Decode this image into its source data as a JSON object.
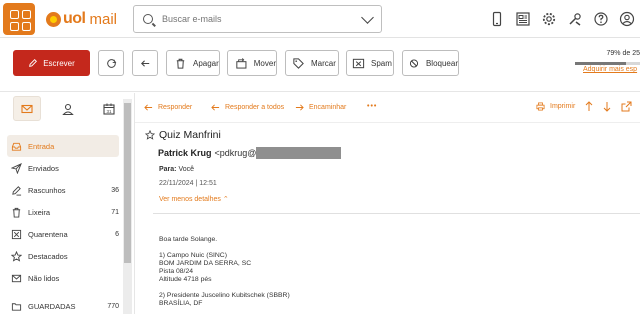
{
  "header": {
    "brand": "uol",
    "product": "mail",
    "search_placeholder": "Buscar e-mails"
  },
  "toolbar": {
    "compose": "Escrever",
    "delete": "Apagar",
    "move": "Mover",
    "mark": "Marcar",
    "spam": "Spam",
    "block": "Bloquear",
    "quota_text": "79% de 25",
    "quota_percent": 79,
    "quota_link": "Adquirir mais esp"
  },
  "sidebar": {
    "folders": [
      {
        "label": "Entrada",
        "count": ""
      },
      {
        "label": "Enviados",
        "count": ""
      },
      {
        "label": "Rascunhos",
        "count": "36"
      },
      {
        "label": "Lixeira",
        "count": "71"
      },
      {
        "label": "Quarentena",
        "count": "6"
      },
      {
        "label": "Destacados",
        "count": ""
      },
      {
        "label": "Não lidos",
        "count": ""
      },
      {
        "label": "GUARDADAS",
        "count": "770"
      }
    ]
  },
  "actions": {
    "reply": "Responder",
    "reply_all": "Responder a todos",
    "forward": "Encaminhar",
    "more": "•••",
    "print": "Imprimir"
  },
  "message": {
    "subject": "Quiz Manfrini",
    "sender_name": "Patrick Krug",
    "sender_email_prefix": "<pdkrug@",
    "to_label": "Para:",
    "to_value": "Você",
    "date": "22/11/2024 | 12:51",
    "details_link": "Ver menos detalhes",
    "body": [
      "Boa tarde Solange.",
      "",
      "1) Campo Nuic (SINC)",
      "BOM JARDIM DA SERRA, SC",
      "Pista 08/24",
      "Altitude 4718 pés",
      "",
      "2) Presidente Juscelino Kubitschek (SBBR)",
      "BRASÍLIA, DF"
    ]
  }
}
